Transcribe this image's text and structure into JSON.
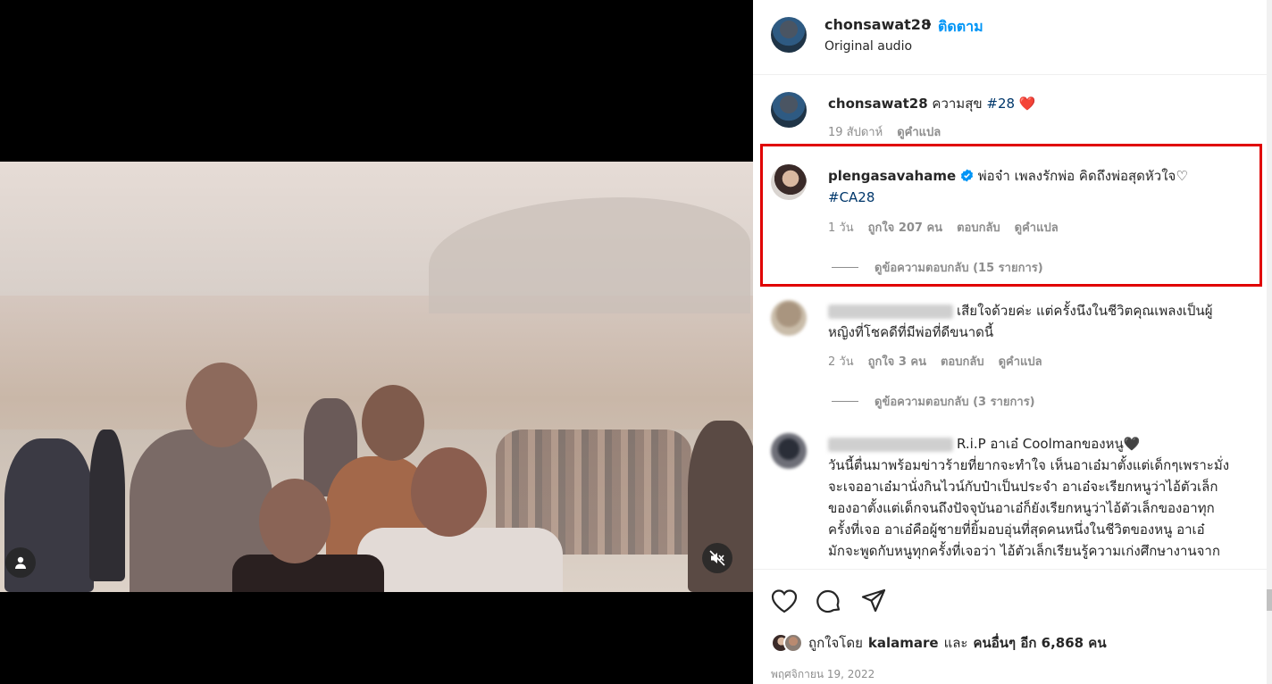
{
  "header": {
    "username": "chonsawat28",
    "separator": "•",
    "follow_label": "ติดตาม",
    "audio": "Original audio"
  },
  "caption": {
    "username": "chonsawat28",
    "text": "ความสุข",
    "hashtag": "#28",
    "emoji": "❤️",
    "time": "19 สัปดาห์",
    "translate": "ดูคำแปล"
  },
  "comments": [
    {
      "username": "plengasavahame",
      "verified": true,
      "text": "พ่อจ๋า เพลงรักพ่อ คิดถึงพ่อสุดหัวใจ♡",
      "hashtag": "#CA28",
      "time": "1 วัน",
      "likes": "ถูกใจ 207 คน",
      "reply": "ตอบกลับ",
      "translate": "ดูคำแปล",
      "view_replies": "ดูข้อความตอบกลับ (15 รายการ)"
    },
    {
      "text": "เสียใจด้วยค่ะ แต่ครั้งนึงในชีวิตคุณเพลงเป็นผู้หญิงที่โชคดีที่มีพ่อที่ดีขนาดนี้",
      "line1": "เสียใจด้วยค่ะ แต่ครั้งนึงในชีวิตคุณเพลงเป็นผู้",
      "line2": "หญิงที่โชคดีที่มีพ่อที่ดีขนาดนี้",
      "time": "2 วัน",
      "likes": "ถูกใจ 3 คน",
      "reply": "ตอบกลับ",
      "translate": "ดูคำแปล",
      "view_replies": "ดูข้อความตอบกลับ (3 รายการ)"
    },
    {
      "line1": "R.i.P อาเอ๋ Coolmanของหนู🖤",
      "line2": "วันนี้ตื่นมาพร้อมข่าวร้ายที่ยากจะทำใจ เห็นอาเอ๋มาตั้งแต่เด็กๆเพราะมั่ง",
      "line3": "จะเจออาเอ๋มานั่งกินไวน์กับป๋าเป็นประจำ อาเอ๋จะเรียกหนูว่าไอ้ตัวเล็ก",
      "line4": "ของอาตั้งแต่เด็กจนถึงปัจจุบันอาเอ๋ก็ยังเรียกหนูว่าไอ้ตัวเล็กของอาทุก",
      "line5": "ครั้งที่เจอ อาเอ๋คือผู้ชายที่ยิ้มอบอุ่นที่สุดคนหนึ่งในชีวิตของหนู อาเอ๋",
      "line6": "มักจะพูดกับหนูทุกครั้งที่เจอว่า ไอ้ตัวเล็กเรียนรู้ความเก่งศึกษางานจาก"
    }
  ],
  "likes": {
    "liked_by": "ถูกใจโดย",
    "user": "kalamare",
    "and": "และ",
    "others": "คนอื่นๆ อีก 6,868 คน"
  },
  "date": "พฤศจิกายน 19, 2022",
  "icons": {
    "like": "heart-icon",
    "comment": "comment-icon",
    "share": "share-icon",
    "mute": "muted-speaker-icon",
    "tag": "user-icon",
    "verified": "verified-badge-icon"
  },
  "colors": {
    "link": "#0095f6",
    "highlight": "#e00000",
    "verified": "#0095f6"
  }
}
